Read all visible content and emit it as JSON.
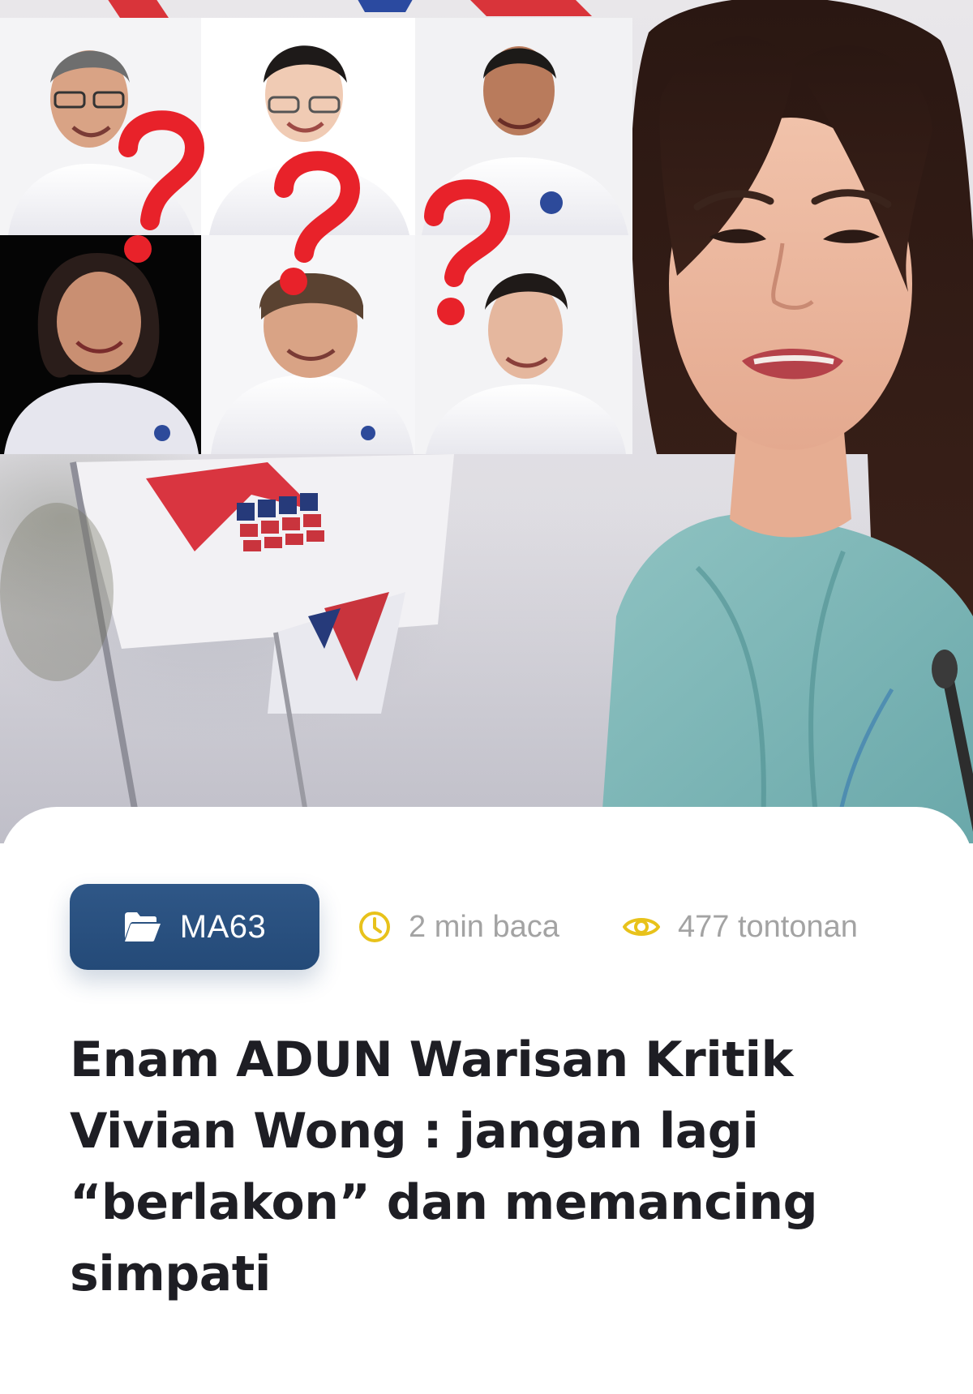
{
  "article": {
    "category": "MA63",
    "category_icon": "folder-open-icon",
    "read_time": "2 min baca",
    "read_time_icon": "clock-icon",
    "views": "477 tontonan",
    "views_icon": "eye-icon",
    "headline": "Enam ADUN Warisan Kritik Vivian Wong : jangan lagi “berlakon” dan memancing simpati"
  },
  "colors": {
    "category_pill": "#2f5787",
    "meta_icon": "#e8c21b",
    "meta_text": "#a3a3a3",
    "headline_text": "#1e1e24",
    "question_mark": "#e8222a"
  }
}
